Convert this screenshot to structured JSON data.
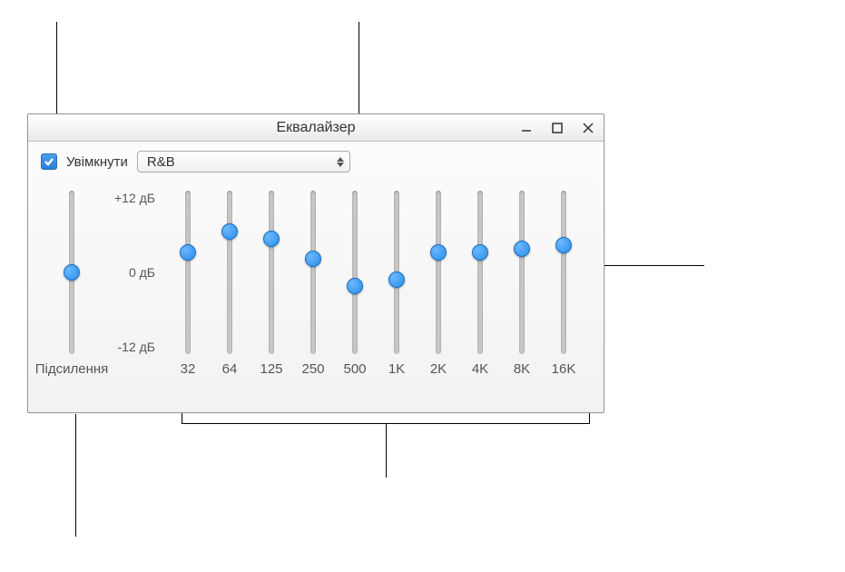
{
  "window": {
    "title": "Еквалайзер"
  },
  "enable": {
    "label": "Увімкнути",
    "checked": true
  },
  "preset": {
    "selected": "R&B"
  },
  "dbLabels": {
    "max": "+12 дБ",
    "mid": "0 дБ",
    "min": "-12 дБ"
  },
  "preamp": {
    "label": "Підсилення",
    "value": 0
  },
  "bands": [
    {
      "freq": "32",
      "value": 3
    },
    {
      "freq": "64",
      "value": 6
    },
    {
      "freq": "125",
      "value": 5
    },
    {
      "freq": "250",
      "value": 2
    },
    {
      "freq": "500",
      "value": -2
    },
    {
      "freq": "1K",
      "value": -1
    },
    {
      "freq": "2K",
      "value": 3
    },
    {
      "freq": "4K",
      "value": 3
    },
    {
      "freq": "8K",
      "value": 3.5
    },
    {
      "freq": "16K",
      "value": 4
    }
  ]
}
